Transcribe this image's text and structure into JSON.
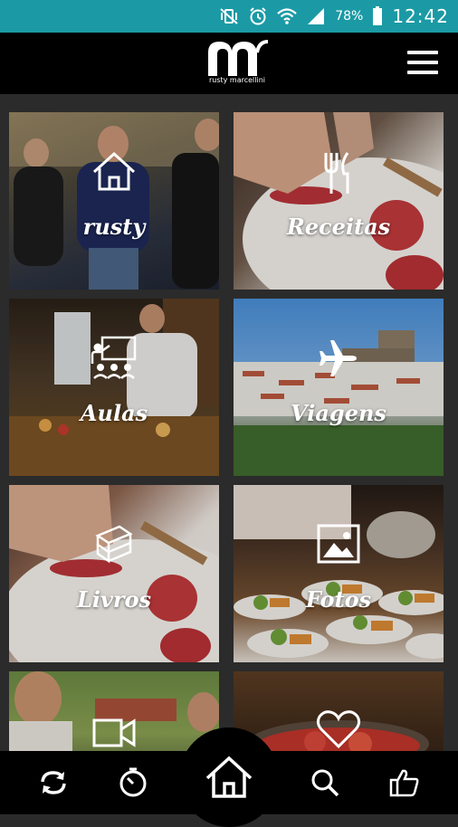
{
  "status_bar": {
    "battery_percent": "78%",
    "time": "12:42",
    "icons": [
      "vibrate-mute-icon",
      "alarm-icon",
      "wifi-icon",
      "signal-icon",
      "battery-icon"
    ]
  },
  "header": {
    "logo_text": "rusty marcellini",
    "menu_icon": "hamburger-menu-icon"
  },
  "tiles": [
    {
      "label": "rusty",
      "icon": "home-outline-icon"
    },
    {
      "label": "Receitas",
      "icon": "fork-knife-icon"
    },
    {
      "label": "Aulas",
      "icon": "classroom-icon"
    },
    {
      "label": "Viagens",
      "icon": "airplane-icon"
    },
    {
      "label": "Livros",
      "icon": "books-icon"
    },
    {
      "label": "Fotos",
      "icon": "picture-icon"
    },
    {
      "label": "",
      "icon": "video-camera-icon"
    },
    {
      "label": "",
      "icon": "heart-icon"
    }
  ],
  "bottom_nav": {
    "items": [
      "refresh-icon",
      "timer-icon",
      "home-icon",
      "search-icon",
      "thumbs-up-icon"
    ]
  },
  "colors": {
    "status_bar": "#1b9aa5",
    "header": "#000000",
    "grid_background": "#2b2b2b"
  }
}
